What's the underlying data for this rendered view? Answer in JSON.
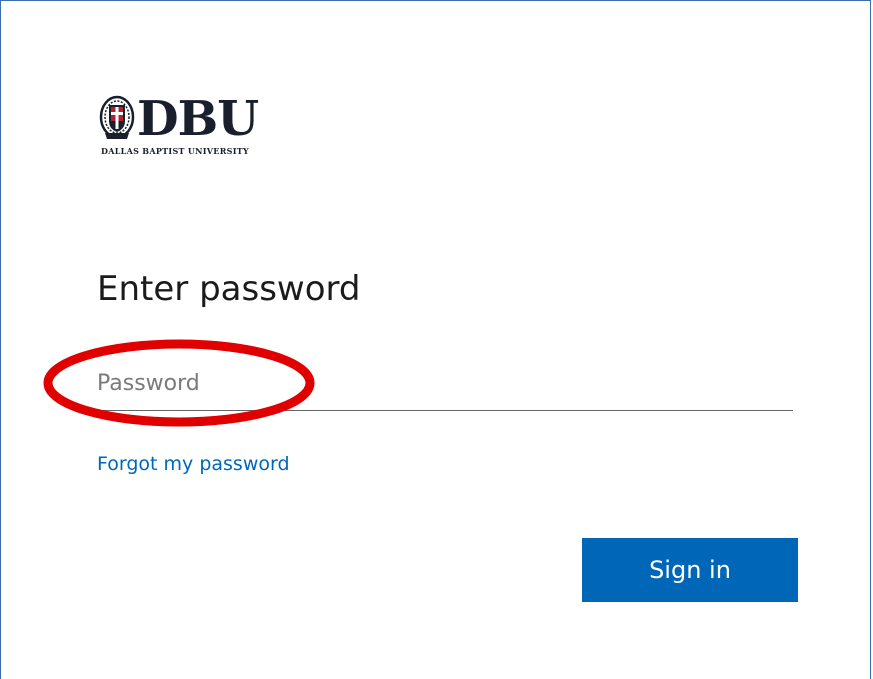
{
  "logo": {
    "letters": "DBU",
    "subtitle": "DALLAS BAPTIST UNIVERSITY",
    "icon": "university-seal-icon"
  },
  "page": {
    "title": "Enter password"
  },
  "password": {
    "placeholder": "Password",
    "value": ""
  },
  "links": {
    "forgot_label": "Forgot my password"
  },
  "actions": {
    "signin_label": "Sign in"
  },
  "colors": {
    "accent": "#0067b8",
    "annotation": "#e00000",
    "frame_border": "#3c6fb0"
  }
}
